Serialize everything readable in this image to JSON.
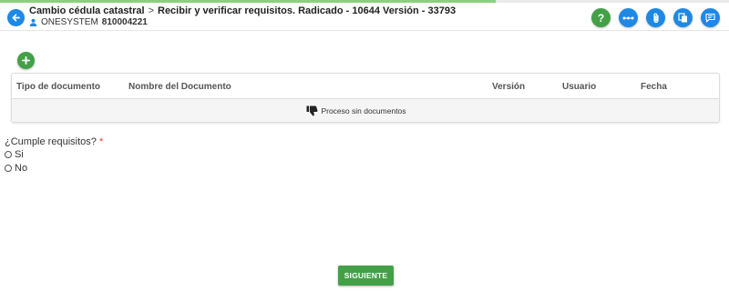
{
  "progress": {
    "fraction": 0.68,
    "color": "#8ccf7e"
  },
  "header": {
    "breadcrumb_parent": "Cambio cédula catastral",
    "breadcrumb_separator": ">",
    "breadcrumb_current": "Recibir y verificar requisitos. Radicado - 10644 Versión - 33793",
    "user_name": "ONESYSTEM",
    "user_id": "810004221"
  },
  "toolbar": {
    "icons": [
      "help-icon",
      "more-icon",
      "attach-icon",
      "documents-icon",
      "comments-icon"
    ],
    "help_label": "?"
  },
  "documents_table": {
    "columns": [
      "Tipo de documento",
      "Nombre del Documento",
      "Versión",
      "Usuario",
      "Fecha"
    ],
    "empty_message": "Proceso sin documentos"
  },
  "form": {
    "question": "¿Cumple requisitos?",
    "required_mark": "*",
    "options": [
      "Si",
      "No"
    ],
    "selected": null
  },
  "footer": {
    "next_label": "SIGUIENTE"
  },
  "colors": {
    "primary_blue": "#1e88e5",
    "primary_green": "#43a047",
    "required_red": "#e53935"
  }
}
